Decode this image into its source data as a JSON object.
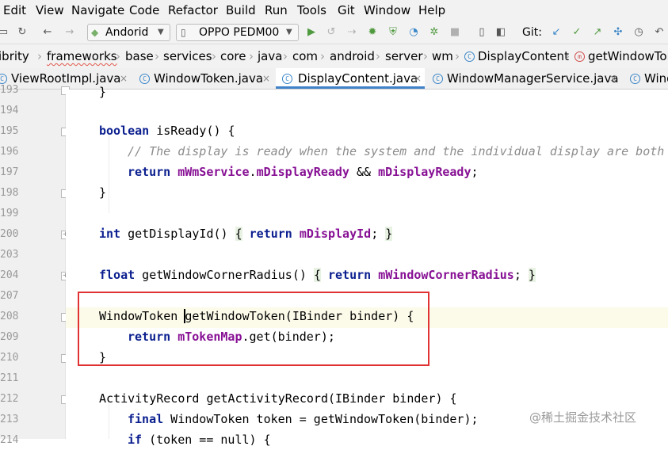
{
  "menu": [
    "Edit",
    "View",
    "Navigate",
    "Code",
    "Refactor",
    "Build",
    "Run",
    "Tools",
    "Git",
    "Window",
    "Help"
  ],
  "toolbar": {
    "config_label": "Andorid",
    "device_label": "OPPO PEDM00",
    "git_label": "Git:"
  },
  "breadcrumbs": [
    "ibrity",
    "frameworks",
    "base",
    "services",
    "core",
    "java",
    "com",
    "android",
    "server",
    "wm",
    "DisplayContent",
    "getWindowTok"
  ],
  "breadcrumb_icons": {
    "class_letter": "C",
    "method_letter": "m"
  },
  "tabs": [
    {
      "label": "ViewRootImpl.java",
      "icon": "C"
    },
    {
      "label": "WindowToken.java",
      "icon": "C"
    },
    {
      "label": "DisplayContent.java",
      "icon": "C",
      "active": true
    },
    {
      "label": "WindowManagerService.java",
      "icon": "C"
    },
    {
      "label": "Wind",
      "icon": "C"
    }
  ],
  "tab_close": "×",
  "line_numbers": [
    "193",
    "194",
    "195",
    "196",
    "197",
    "198",
    "199",
    "200",
    "203",
    "204",
    "207",
    "208",
    "209",
    "210",
    "211",
    "212",
    "213",
    "214"
  ],
  "code": {
    "l193": "}",
    "l195_kw": "boolean",
    "l195_rest": " isReady() {",
    "l196": "// The display is ready when the system and the individual display are both",
    "l197_kw": "return",
    "l197_f1": "mWmService",
    "l197_dot": ".",
    "l197_f2": "mDisplayReady",
    "l197_op": " && ",
    "l197_f3": "mDisplayReady",
    "l197_end": ";",
    "l198": "}",
    "l200_kw": "int",
    "l200_name": " getDisplayId() ",
    "l200_ob": "{",
    "l200_ret": "return",
    "l200_f": "mDisplayId",
    "l200_semi": ";",
    "l200_cb": "}",
    "l204_kw": "float",
    "l204_name": " getWindowCornerRadius() ",
    "l204_ob": "{",
    "l204_ret": "return",
    "l204_f": "mWindowCornerRadius",
    "l204_semi": ";",
    "l204_cb": "}",
    "l208": "WindowToken getWindowToken(IBinder binder) {",
    "l209_kw": "return",
    "l209_f": "mTokenMap",
    "l209_rest": ".get(binder);",
    "l210": "}",
    "l212": "ActivityRecord getActivityRecord(IBinder binder) {",
    "l213_kw": "final",
    "l213_rest": " WindowToken token = getWindowToken(binder);",
    "l214_kw": "if",
    "l214_rest": " (token == null) {"
  },
  "watermark": "@稀土掘金技术社区",
  "colors": {
    "keyword": "#0b1f8f",
    "field": "#871094",
    "comment": "#8c8c8c",
    "highlight_box": "#e03232",
    "active_tab": "#4083c9"
  }
}
